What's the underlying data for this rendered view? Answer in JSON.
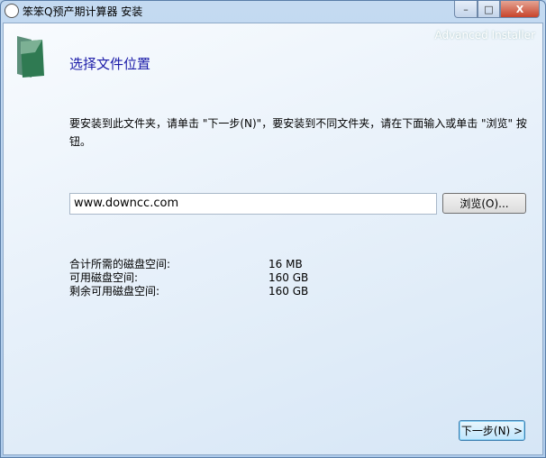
{
  "window": {
    "title": "笨笨Q预产期计算器 安装",
    "minimize": "–",
    "maximize": "□",
    "close": "X"
  },
  "brand": "Advanced Installer",
  "heading": "选择文件位置",
  "description": "要安装到此文件夹，请单击 \"下一步(N)\"，要安装到不同文件夹，请在下面输入或单击 \"浏览\" 按钮。",
  "path": {
    "value": "www.downcc.com"
  },
  "browse_label": "浏览(O)...",
  "space": [
    {
      "label": "合计所需的磁盘空间:",
      "value": "16 MB"
    },
    {
      "label": "可用磁盘空间:",
      "value": "160 GB"
    },
    {
      "label": "剩余可用磁盘空间:",
      "value": "160 GB"
    }
  ],
  "next_label": "下一步(N) >"
}
